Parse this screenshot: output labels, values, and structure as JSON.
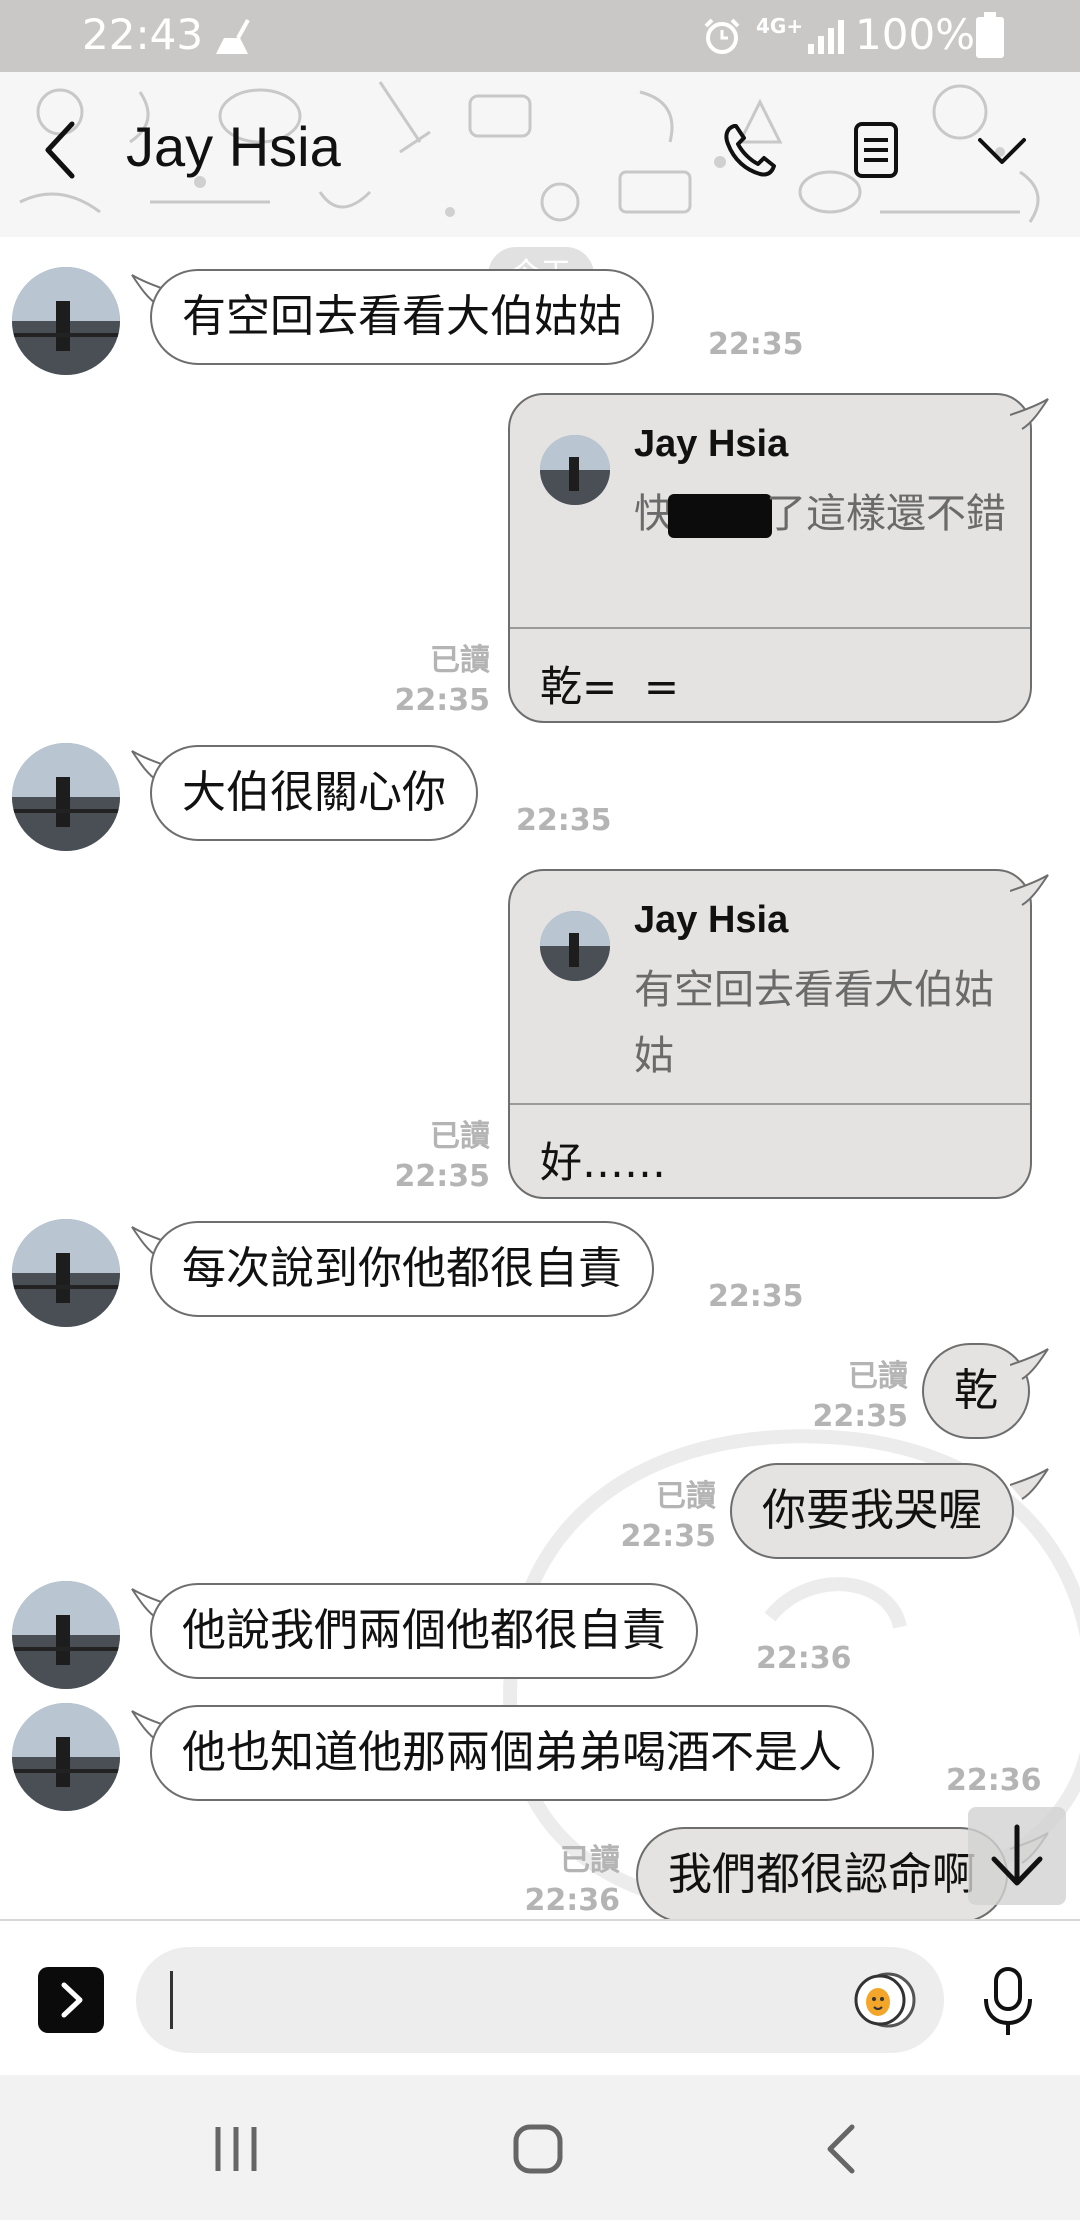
{
  "status_bar": {
    "time": "22:43",
    "network": "4G+",
    "battery": "100%"
  },
  "header": {
    "title": "Jay Hsia",
    "icons": [
      "back-chevron-icon",
      "phone-icon",
      "notes-icon",
      "chevron-down-icon"
    ]
  },
  "chat": {
    "date_divider": "今天",
    "messages": [
      {
        "side": "in",
        "text": "有空回去看看大伯姑姑",
        "time": "22:35"
      },
      {
        "side": "out",
        "type": "reply",
        "reply_to_name": "Jay Hsia",
        "reply_to_text_before": "快",
        "reply_to_text_after": "了這樣還不錯",
        "text": "乾=  =",
        "read": "已讀",
        "time": "22:35"
      },
      {
        "side": "in",
        "text": "大伯很關心你",
        "time": "22:35"
      },
      {
        "side": "out",
        "type": "reply",
        "reply_to_name": "Jay Hsia",
        "reply_to_text": "有空回去看看大伯姑姑",
        "text": "好……",
        "read": "已讀",
        "time": "22:35"
      },
      {
        "side": "in",
        "text": "每次說到你他都很自責",
        "time": "22:35"
      },
      {
        "side": "out",
        "text": "乾",
        "read": "已讀",
        "time": "22:35"
      },
      {
        "side": "out",
        "text": "你要我哭喔",
        "read": "已讀",
        "time": "22:35"
      },
      {
        "side": "in",
        "text": "他說我們兩個他都很自責",
        "time": "22:36"
      },
      {
        "side": "in",
        "text": "他也知道他那兩個弟弟喝酒不是人",
        "time": "22:36"
      },
      {
        "side": "out",
        "text": "我們都很認命啊",
        "read": "已讀",
        "time": "22:36"
      }
    ]
  },
  "input_bar": {
    "placeholder": "",
    "value": ""
  },
  "colors": {
    "incoming_bubble": "#ffffff",
    "outgoing_bubble": "#e4e3e2",
    "bubble_border": "#6e6e6e",
    "meta_text": "#b4b4b4",
    "status_bar": "#c9c8c6"
  }
}
